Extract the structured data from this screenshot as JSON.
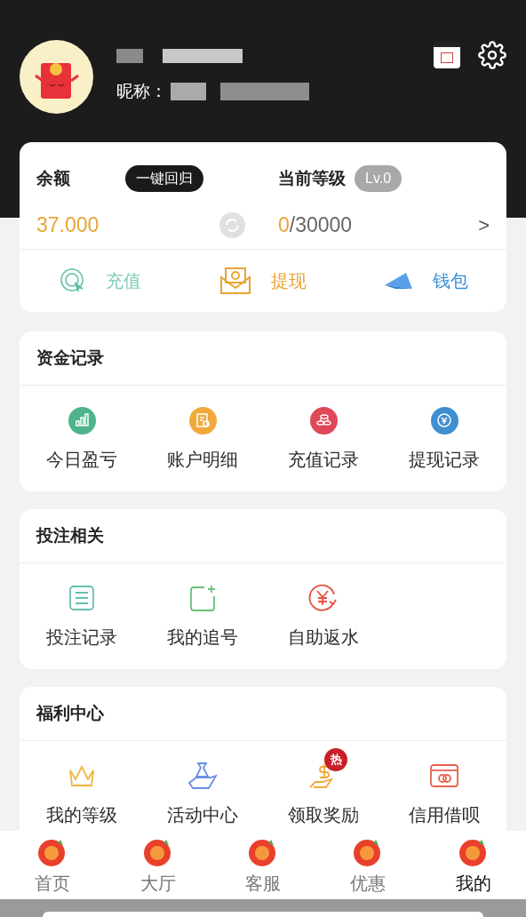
{
  "profile": {
    "nickname_label": "昵称："
  },
  "balance": {
    "label": "余额",
    "return_button": "一键回归",
    "amount": "37.000"
  },
  "level": {
    "label": "当前等级",
    "badge": "Lv.0",
    "progress_current": "0",
    "progress_total": "/30000",
    "arrow": ">"
  },
  "actions": [
    {
      "kind": "recharge",
      "label": "充值"
    },
    {
      "kind": "withdraw",
      "label": "提现"
    },
    {
      "kind": "wallet",
      "label": "钱包"
    }
  ],
  "sections": [
    {
      "title": "资金记录",
      "items": [
        {
          "kind": "chart",
          "label": "今日盈亏"
        },
        {
          "kind": "statement",
          "label": "账户明细"
        },
        {
          "kind": "coins",
          "label": "充值记录"
        },
        {
          "kind": "yen-circle",
          "label": "提现记录"
        }
      ]
    },
    {
      "title": "投注相关",
      "items": [
        {
          "kind": "list",
          "label": "投注记录"
        },
        {
          "kind": "square-plus",
          "label": "我的追号"
        },
        {
          "kind": "yen-arrow",
          "label": "自助返水"
        }
      ]
    },
    {
      "title": "福利中心",
      "items": [
        {
          "kind": "crown",
          "label": "我的等级"
        },
        {
          "kind": "bag",
          "label": "活动中心"
        },
        {
          "kind": "dollar-hand",
          "label": "领取奖励",
          "badge": "热"
        },
        {
          "kind": "card",
          "label": "信用借呗"
        }
      ]
    }
  ],
  "tabs": [
    {
      "label": "首页",
      "selected": false
    },
    {
      "label": "大厅",
      "selected": false
    },
    {
      "label": "客服",
      "selected": false
    },
    {
      "label": "优惠",
      "selected": false
    },
    {
      "label": "我的",
      "selected": true
    }
  ]
}
